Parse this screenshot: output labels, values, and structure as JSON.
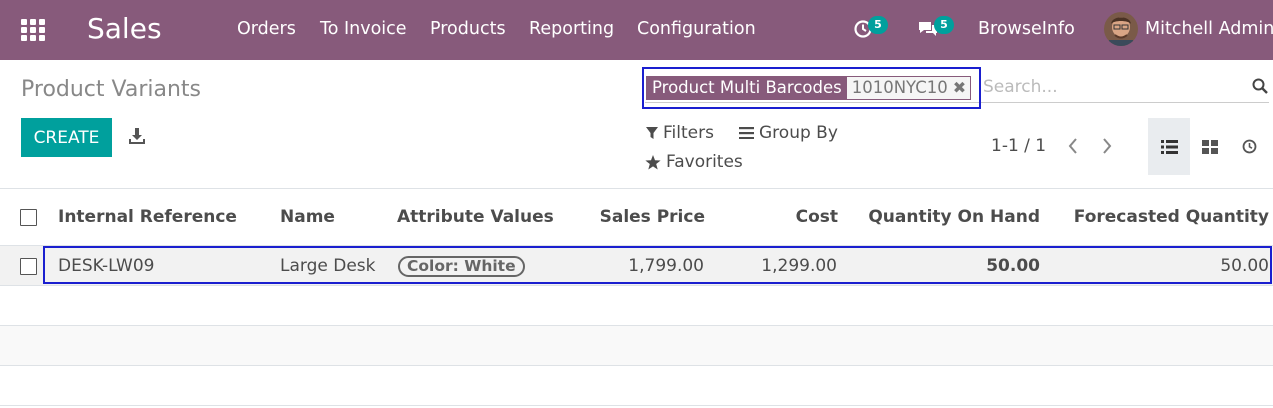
{
  "navbar": {
    "app_name": "Sales",
    "menu": [
      "Orders",
      "To Invoice",
      "Products",
      "Reporting",
      "Configuration"
    ],
    "activity_count": "5",
    "messages_count": "5",
    "company": "BrowseInfo",
    "user": "Mitchell Admin",
    "bg_color": "#875a7b"
  },
  "control_panel": {
    "title": "Product Variants",
    "create_label": "CREATE",
    "search": {
      "facet_label": "Product Multi Barcodes",
      "facet_value": "1010NYC10",
      "placeholder": "Search..."
    },
    "filters_label": "Filters",
    "group_by_label": "Group By",
    "favorites_label": "Favorites",
    "pager": "1-1 / 1",
    "accent_color": "#00a09d",
    "highlight_color": "#1a1fcf"
  },
  "table": {
    "columns": [
      "Internal Reference",
      "Name",
      "Attribute Values",
      "Sales Price",
      "Cost",
      "Quantity On Hand",
      "Forecasted Quantity"
    ],
    "rows": [
      {
        "internal_reference": "DESK-LW09",
        "name": "Large Desk",
        "attribute_values": "Color: White",
        "sales_price": "1,799.00",
        "cost": "1,299.00",
        "qty_on_hand": "50.00",
        "forecasted_qty": "50.00"
      }
    ]
  }
}
